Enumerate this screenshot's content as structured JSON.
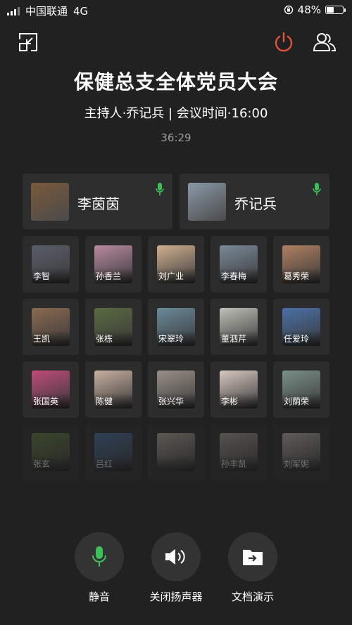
{
  "status": {
    "carrier": "中国联通",
    "network": "4G",
    "battery": "48%",
    "battery_level": 0.48
  },
  "meeting": {
    "title": "保健总支全体党员大会",
    "subtitle": "主持人·乔记兵 | 会议时间·16:00",
    "timer": "36:29"
  },
  "hosts": [
    {
      "name": "李茵茵",
      "color": "#7a5a3a"
    },
    {
      "name": "乔记兵",
      "color": "#8a9aa8"
    }
  ],
  "participants": [
    {
      "name": "李智",
      "color": "#5a5e6a"
    },
    {
      "name": "孙香兰",
      "color": "#b88aa0"
    },
    {
      "name": "刘广业",
      "color": "#d0b090"
    },
    {
      "name": "李春梅",
      "color": "#7a8a98"
    },
    {
      "name": "葛秀荣",
      "color": "#b08060"
    },
    {
      "name": "王凯",
      "color": "#8a6a50"
    },
    {
      "name": "张栋",
      "color": "#5a6a40"
    },
    {
      "name": "宋翠玲",
      "color": "#6a8a9a"
    },
    {
      "name": "董泗芹",
      "color": "#c0c0b8"
    },
    {
      "name": "任爱玲",
      "color": "#4a70a8"
    },
    {
      "name": "张国英",
      "color": "#c04a7a"
    },
    {
      "name": "陈健",
      "color": "#c8b0a0"
    },
    {
      "name": "张兴华",
      "color": "#9a9088"
    },
    {
      "name": "李彬",
      "color": "#d8c8c0"
    },
    {
      "name": "刘荫荣",
      "color": "#7a9088"
    },
    {
      "name": "张玄",
      "color": "#6a8a40"
    },
    {
      "name": "吕红",
      "color": "#4a78b8"
    },
    {
      "name": "",
      "color": "#c8c0b0"
    },
    {
      "name": "孙丰凯",
      "color": "#b8b0a8"
    },
    {
      "name": "刘军妮",
      "color": "#d0c8c0"
    }
  ],
  "controls": [
    {
      "label": "静音",
      "icon": "microphone-icon"
    },
    {
      "label": "关闭扬声器",
      "icon": "speaker-icon"
    },
    {
      "label": "文档演示",
      "icon": "folder-share-icon"
    }
  ],
  "colors": {
    "background": "#212121",
    "card": "#2e2e2e",
    "mic_green": "#3fbf5a",
    "power_red": "#e0533d"
  }
}
